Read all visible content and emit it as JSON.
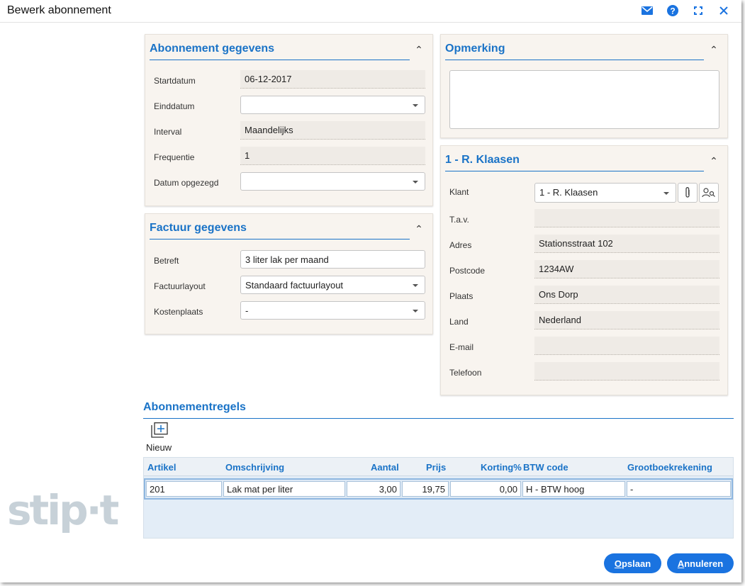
{
  "window": {
    "title": "Bewerk abonnement"
  },
  "titlebar_icons": [
    "mail-icon",
    "help-icon",
    "maximize-icon",
    "close-icon"
  ],
  "colors": {
    "accent": "#1a73c7",
    "button": "#1a73e0",
    "panel_bg": "#f8f4ef",
    "grid_bg": "#e3edf7"
  },
  "logo": {
    "text": "stip·t"
  },
  "abonnement": {
    "title": "Abonnement gegevens",
    "startdatum_label": "Startdatum",
    "startdatum_value": "06-12-2017",
    "einddatum_label": "Einddatum",
    "einddatum_value": "",
    "interval_label": "Interval",
    "interval_value": "Maandelijks",
    "frequentie_label": "Frequentie",
    "frequentie_value": "1",
    "opgezegd_label": "Datum opgezegd",
    "opgezegd_value": ""
  },
  "factuur": {
    "title": "Factuur gegevens",
    "betreft_label": "Betreft",
    "betreft_value": "3 liter lak per maand",
    "layout_label": "Factuurlayout",
    "layout_value": "Standaard factuurlayout",
    "kostenplaats_label": "Kostenplaats",
    "kostenplaats_value": "-"
  },
  "opmerking": {
    "title": "Opmerking",
    "value": ""
  },
  "klant": {
    "title": "1 - R. Klaasen",
    "klant_label": "Klant",
    "klant_value": "1 - R. Klaasen",
    "tav_label": "T.a.v.",
    "tav_value": "",
    "adres_label": "Adres",
    "adres_value": "Stationsstraat 102",
    "postcode_label": "Postcode",
    "postcode_value": "1234AW",
    "plaats_label": "Plaats",
    "plaats_value": "Ons Dorp",
    "land_label": "Land",
    "land_value": "Nederland",
    "email_label": "E-mail",
    "email_value": "",
    "telefoon_label": "Telefoon",
    "telefoon_value": ""
  },
  "regels": {
    "title": "Abonnementregels",
    "new_label": "Nieuw",
    "columns": [
      "Artikel",
      "Omschrijving",
      "Aantal",
      "Prijs",
      "Korting%",
      "BTW code",
      "Grootboekrekening"
    ],
    "rows": [
      {
        "artikel": "201",
        "omschrijving": "Lak mat per liter",
        "aantal": "3,00",
        "prijs": "19,75",
        "korting": "0,00",
        "btw": "H - BTW hoog",
        "grootboek": "-"
      }
    ]
  },
  "buttons": {
    "save_first": "O",
    "save_rest": "pslaan",
    "cancel_first": "A",
    "cancel_rest": "nnuleren"
  }
}
